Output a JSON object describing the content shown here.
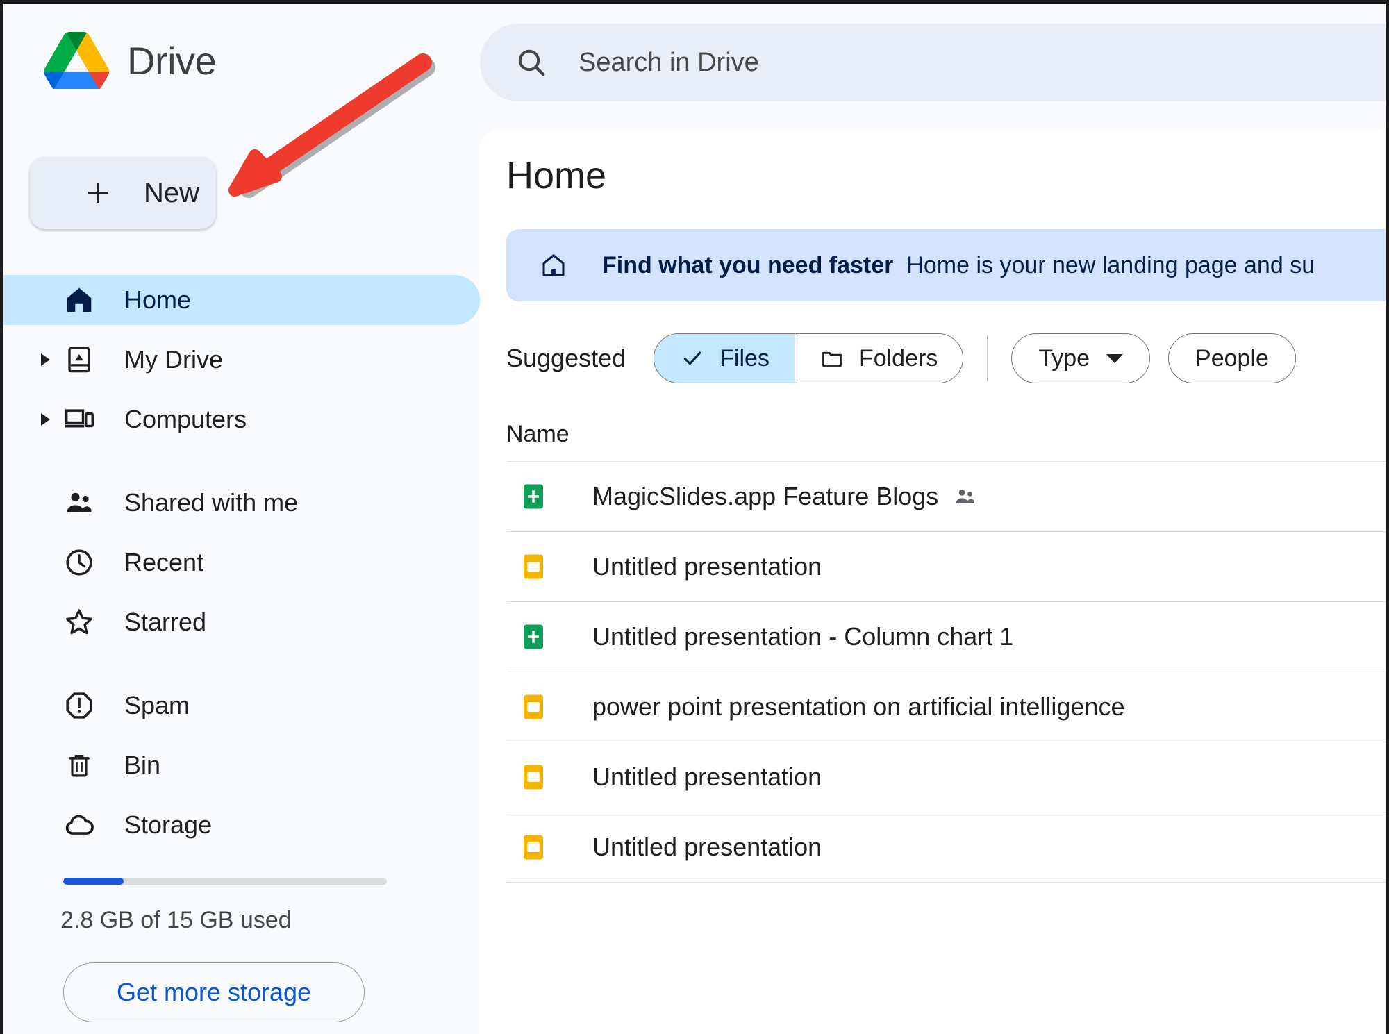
{
  "app": {
    "brand_name": "Drive",
    "logo_colors": {
      "green": "#34a853",
      "yellow": "#fbbc04",
      "blue": "#1a73e8",
      "red": "#ea4335",
      "dark_green": "#188038"
    }
  },
  "sidebar": {
    "new_button": {
      "label": "New",
      "icon": "plus-icon"
    },
    "items": [
      {
        "label": "Home",
        "icon": "home-icon",
        "active": true,
        "expandable": false
      },
      {
        "label": "My Drive",
        "icon": "my-drive-icon",
        "active": false,
        "expandable": true
      },
      {
        "label": "Computers",
        "icon": "computers-icon",
        "active": false,
        "expandable": true
      },
      {
        "label": "Shared with me",
        "icon": "people-icon",
        "active": false,
        "expandable": false
      },
      {
        "label": "Recent",
        "icon": "clock-icon",
        "active": false,
        "expandable": false
      },
      {
        "label": "Starred",
        "icon": "star-icon",
        "active": false,
        "expandable": false
      },
      {
        "label": "Spam",
        "icon": "spam-icon",
        "active": false,
        "expandable": false
      },
      {
        "label": "Bin",
        "icon": "trash-icon",
        "active": false,
        "expandable": false
      },
      {
        "label": "Storage",
        "icon": "cloud-icon",
        "active": false,
        "expandable": false
      }
    ],
    "storage": {
      "used_text": "2.8 GB of 15 GB used",
      "percent": 18.7,
      "bar_color": "#1a56db",
      "get_more_label": "Get more storage"
    }
  },
  "search": {
    "placeholder": "Search in Drive",
    "icon": "search-icon"
  },
  "main": {
    "page_title": "Home",
    "banner": {
      "icon": "home-icon",
      "headline": "Find what you need faster",
      "body": "Home is your new landing page and su",
      "bg_color": "#d3e3fd",
      "text_color": "#041e49"
    },
    "filters": {
      "suggested_label": "Suggested",
      "segments": [
        {
          "label": "Files",
          "icon": "check-icon",
          "selected": true
        },
        {
          "label": "Folders",
          "icon": "folder-icon",
          "selected": false
        }
      ],
      "chips": [
        {
          "label": "Type",
          "has_caret": true
        },
        {
          "label": "People",
          "has_caret": false
        }
      ]
    },
    "column_header_name": "Name",
    "files": [
      {
        "name": "MagicSlides.app Feature Blogs",
        "icon": "google-sheets-icon",
        "icon_color": "#0f9d58",
        "shared": true
      },
      {
        "name": "Untitled presentation",
        "icon": "google-slides-icon",
        "icon_color": "#f4b400",
        "shared": false
      },
      {
        "name": "Untitled presentation - Column chart 1",
        "icon": "google-sheets-icon",
        "icon_color": "#0f9d58",
        "shared": false
      },
      {
        "name": "power point presentation on artificial intelligence",
        "icon": "google-slides-icon",
        "icon_color": "#f4b400",
        "shared": false
      },
      {
        "name": "Untitled presentation",
        "icon": "google-slides-icon",
        "icon_color": "#f4b400",
        "shared": false
      },
      {
        "name": "Untitled presentation",
        "icon": "google-slides-icon",
        "icon_color": "#f4b400",
        "shared": false
      }
    ]
  },
  "annotation": {
    "arrow": {
      "color": "#ef3b2d",
      "points_to": "new-button"
    }
  }
}
